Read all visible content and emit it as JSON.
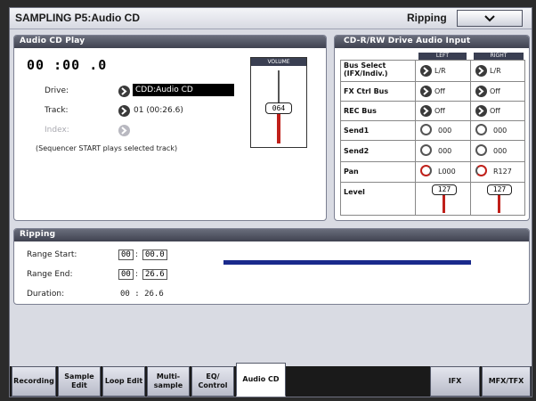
{
  "titlebar": {
    "title": "SAMPLING P5:Audio CD",
    "page": "Ripping"
  },
  "cd_play": {
    "header": "Audio CD Play",
    "time": "00 :00 .0",
    "drive_label": "Drive:",
    "drive_value": "CDD:Audio CD",
    "track_label": "Track:",
    "track_value": "01 (00:26.6)",
    "index_label": "Index:",
    "note": "(Sequencer START plays selected track)",
    "volume_label": "VOLUME",
    "volume_value": "064",
    "volume_level": 0.5
  },
  "drive_input": {
    "header": "CD-R/RW Drive Audio Input",
    "col_left": "LEFT",
    "col_right": "RIGHT",
    "rows": [
      {
        "label": "Bus Select (IFX/Indiv.)",
        "left": "L/R",
        "right": "L/R"
      },
      {
        "label": "FX Ctrl Bus",
        "left": "Off",
        "right": "Off"
      },
      {
        "label": "REC Bus",
        "left": "Off",
        "right": "Off"
      },
      {
        "label": "Send1",
        "left": "000",
        "right": "000"
      },
      {
        "label": "Send2",
        "left": "000",
        "right": "000"
      },
      {
        "label": "Pan",
        "left": "L000",
        "right": "R127"
      },
      {
        "label": "Level",
        "left": "127",
        "right": "127"
      }
    ]
  },
  "ripping": {
    "header": "Ripping",
    "start_label": "Range Start:",
    "start_min": "00",
    "start_sec": "00.0",
    "end_label": "Range End:",
    "end_min": "00",
    "end_sec": "26.6",
    "dur_label": "Duration:",
    "dur_value": "00 : 26.6",
    "sep": ":"
  },
  "tabs": [
    {
      "label": "Recording"
    },
    {
      "label": "Sample Edit"
    },
    {
      "label": "Loop Edit"
    },
    {
      "label": "Multi-sample"
    },
    {
      "label": "EQ/ Control"
    },
    {
      "label": "Audio CD"
    },
    {
      "label": "IFX"
    },
    {
      "label": "MFX/TFX"
    }
  ],
  "colors": {
    "accent_red": "#c0201a",
    "range_bar": "#1a2a8c"
  }
}
